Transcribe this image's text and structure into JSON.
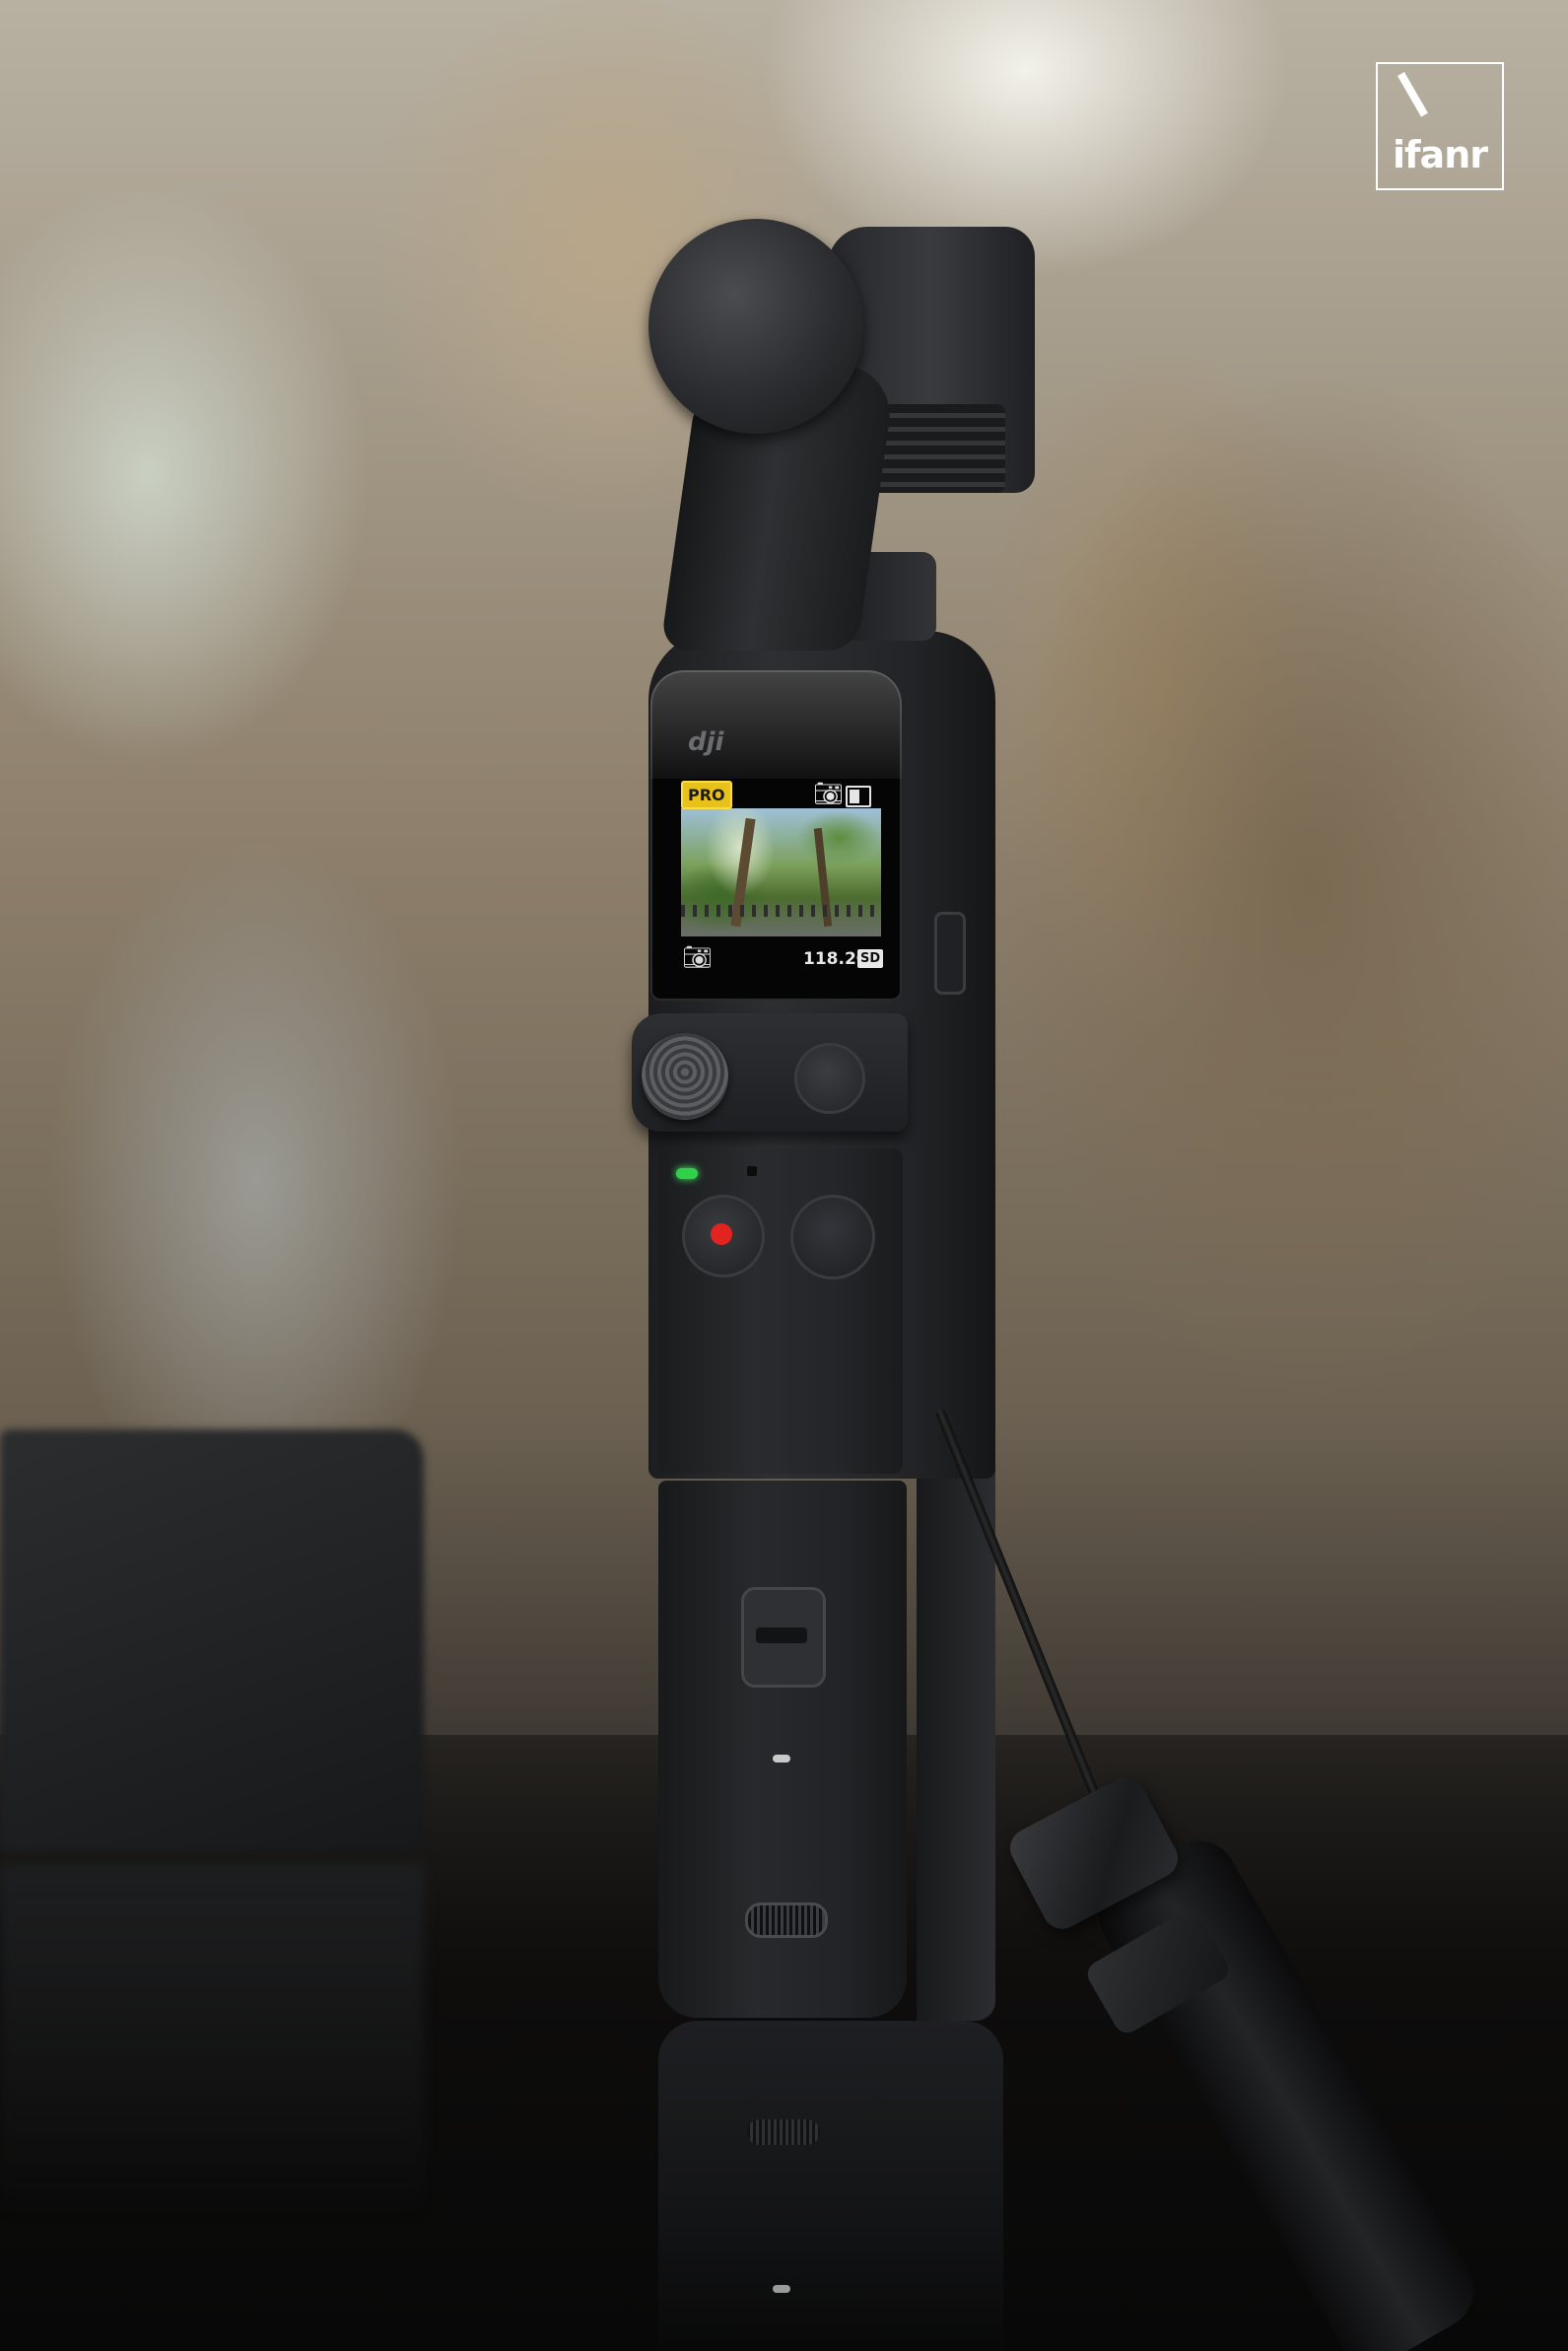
{
  "watermark": {
    "text": "ifanr"
  },
  "device": {
    "logo": "dji",
    "screen": {
      "mode_badge": "PRO",
      "top_right_icons": [
        "camera-icon",
        "battery-icon"
      ],
      "bottom_left_icon": "camera-icon",
      "storage_remaining": "118.2G",
      "storage_type": "SD"
    },
    "status_led_color": "#31d04a",
    "record_dot_color": "#e2231f"
  }
}
